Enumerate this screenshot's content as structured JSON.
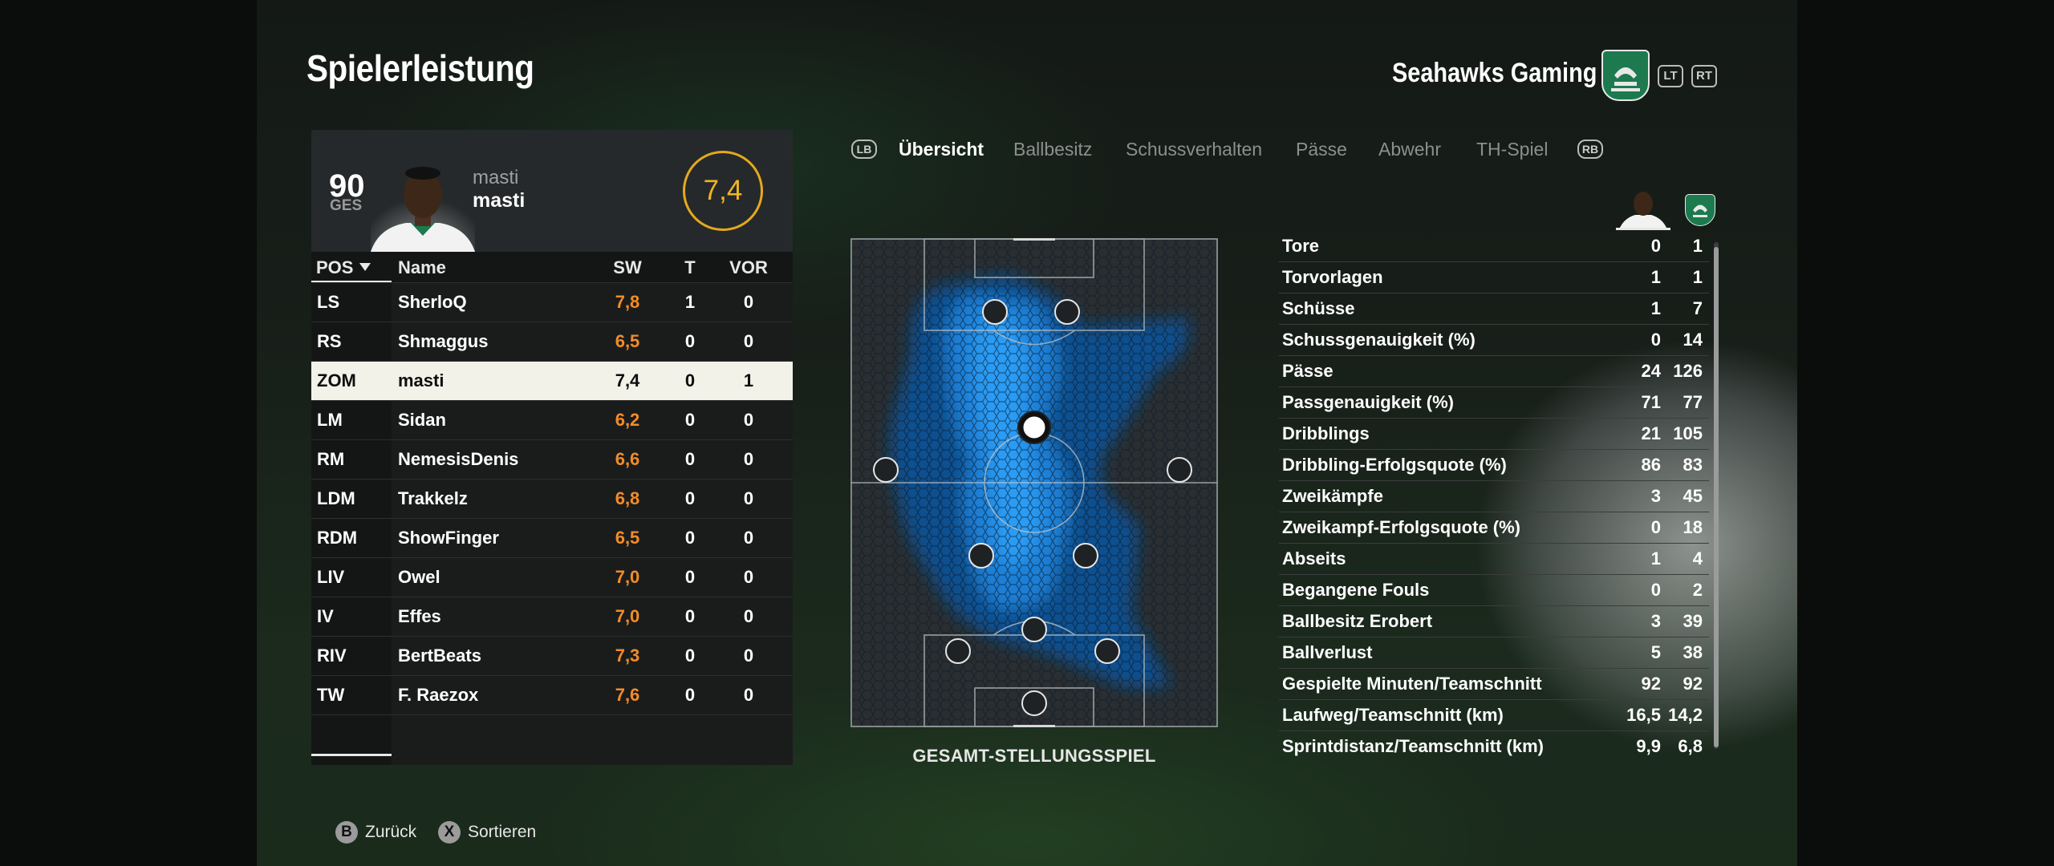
{
  "header": {
    "title": "Spielerleistung",
    "team_name": "Seahawks Gaming",
    "lt_label": "LT",
    "rt_label": "RT"
  },
  "player_card": {
    "overall": "90",
    "overall_label": "GES",
    "name_top": "masti",
    "name": "masti",
    "rating": "7,4"
  },
  "table": {
    "headers": {
      "pos": "POS",
      "name": "Name",
      "sw": "SW",
      "t": "T",
      "vor": "VOR"
    },
    "rows": [
      {
        "pos": "LS",
        "name": "SherloQ",
        "sw": "7,8",
        "t": "1",
        "vor": "0"
      },
      {
        "pos": "RS",
        "name": "Shmaggus",
        "sw": "6,5",
        "t": "0",
        "vor": "0"
      },
      {
        "pos": "ZOM",
        "name": "masti",
        "sw": "7,4",
        "t": "0",
        "vor": "1"
      },
      {
        "pos": "LM",
        "name": "Sidan",
        "sw": "6,2",
        "t": "0",
        "vor": "0"
      },
      {
        "pos": "RM",
        "name": "NemesisDenis",
        "sw": "6,6",
        "t": "0",
        "vor": "0"
      },
      {
        "pos": "LDM",
        "name": "Trakkelz",
        "sw": "6,8",
        "t": "0",
        "vor": "0"
      },
      {
        "pos": "RDM",
        "name": "ShowFinger",
        "sw": "6,5",
        "t": "0",
        "vor": "0"
      },
      {
        "pos": "LIV",
        "name": "Owel",
        "sw": "7,0",
        "t": "0",
        "vor": "0"
      },
      {
        "pos": "IV",
        "name": "Effes",
        "sw": "7,0",
        "t": "0",
        "vor": "0"
      },
      {
        "pos": "RIV",
        "name": "BertBeats",
        "sw": "7,3",
        "t": "0",
        "vor": "0"
      },
      {
        "pos": "TW",
        "name": "F. Raezox",
        "sw": "7,6",
        "t": "0",
        "vor": "0"
      }
    ]
  },
  "tabs": {
    "lb_label": "LB",
    "rb_label": "RB",
    "items": [
      "Übersicht",
      "Ballbesitz",
      "Schussverhalten",
      "Pässe",
      "Abwehr",
      "TH-Spiel"
    ]
  },
  "pitch": {
    "label": "GESAMT-STELLUNGSSPIEL"
  },
  "stats": [
    {
      "label": "Tore",
      "player": "0",
      "team": "1"
    },
    {
      "label": "Torvorlagen",
      "player": "1",
      "team": "1"
    },
    {
      "label": "Schüsse",
      "player": "1",
      "team": "7"
    },
    {
      "label": "Schussgenauigkeit (%)",
      "player": "0",
      "team": "14"
    },
    {
      "label": "Pässe",
      "player": "24",
      "team": "126"
    },
    {
      "label": "Passgenauigkeit (%)",
      "player": "71",
      "team": "77"
    },
    {
      "label": "Dribblings",
      "player": "21",
      "team": "105"
    },
    {
      "label": "Dribbling-Erfolgsquote (%)",
      "player": "86",
      "team": "83"
    },
    {
      "label": "Zweikämpfe",
      "player": "3",
      "team": "45"
    },
    {
      "label": "Zweikampf-Erfolgsquote (%)",
      "player": "0",
      "team": "18"
    },
    {
      "label": "Abseits",
      "player": "1",
      "team": "4"
    },
    {
      "label": "Begangene Fouls",
      "player": "0",
      "team": "2"
    },
    {
      "label": "Ballbesitz Erobert",
      "player": "3",
      "team": "39"
    },
    {
      "label": "Ballverlust",
      "player": "5",
      "team": "38"
    },
    {
      "label": "Gespielte Minuten/Teamschnitt",
      "player": "92",
      "team": "92"
    },
    {
      "label": "Laufweg/Teamschnitt (km)",
      "player": "16,5",
      "team": "14,2"
    },
    {
      "label": "Sprintdistanz/Teamschnitt (km)",
      "player": "9,9",
      "team": "6,8"
    }
  ],
  "footer": {
    "back_key": "B",
    "back_label": "Zurück",
    "sort_key": "X",
    "sort_label": "Sortieren"
  },
  "colors": {
    "accent_rating": "#f0b522",
    "rating_orange": "#f28c28",
    "heatmap": "#1e90ff",
    "crest_green": "#1c7a4e"
  },
  "icons": [
    "team-crest-icon",
    "sort-down-icon",
    "player-portrait-icon",
    "lb-button-icon",
    "rb-button-icon",
    "b-button-icon",
    "x-button-icon"
  ]
}
